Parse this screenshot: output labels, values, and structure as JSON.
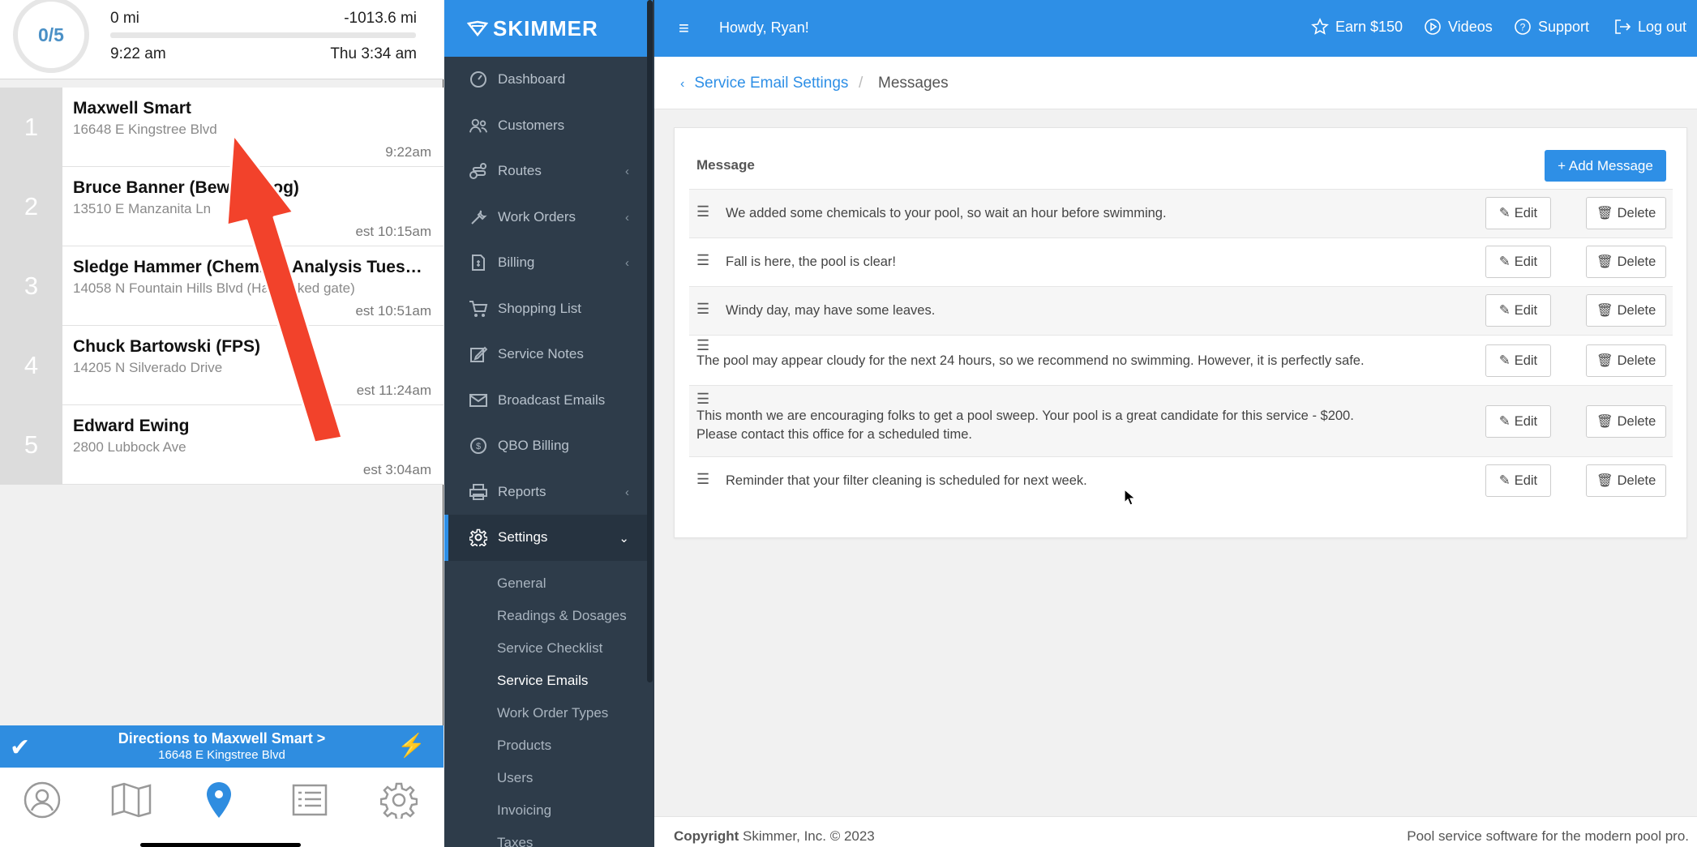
{
  "mobile": {
    "progress": "0/5",
    "distance_left": "0 mi",
    "distance_right": "-1013.6 mi",
    "time_left": "9:22 am",
    "time_right": "Thu 3:34 am",
    "stops": [
      {
        "num": "1",
        "name": "Maxwell Smart",
        "address": "16648 E Kingstree Blvd",
        "time": "9:22am"
      },
      {
        "num": "2",
        "name": "Bruce Banner (Beware Dog)",
        "address": "13510 E Manzanita Ln",
        "time": "est 10:15am"
      },
      {
        "num": "3",
        "name": "Sledge Hammer (Chemical Analysis Tuesday)",
        "address": "14058 N Fountain Hills Blvd (Has locked gate)",
        "time": "est 10:51am"
      },
      {
        "num": "4",
        "name": "Chuck Bartowski (FPS)",
        "address": "14205 N Silverado Drive",
        "time": "est 11:24am"
      },
      {
        "num": "5",
        "name": "Edward Ewing",
        "address": "2800 Lubbock Ave",
        "time": "est 3:04am"
      }
    ],
    "directions_title": "Directions to Maxwell Smart >",
    "directions_address": "16648 E Kingstree Blvd",
    "tabs": [
      "profile-icon",
      "map-icon",
      "location-pin-icon",
      "list-icon",
      "gear-icon"
    ],
    "accent": "#2f8de0"
  },
  "brand": "SKIMMER",
  "topbar": {
    "greeting": "Howdy, Ryan!",
    "earn": "Earn $150",
    "videos": "Videos",
    "support": "Support",
    "logout": "Log out"
  },
  "nav": [
    {
      "label": "Dashboard",
      "icon": "dashboard-icon"
    },
    {
      "label": "Customers",
      "icon": "customers-icon"
    },
    {
      "label": "Routes",
      "icon": "routes-icon"
    },
    {
      "label": "Work Orders",
      "icon": "wrench-icon"
    },
    {
      "label": "Billing",
      "icon": "billing-icon"
    },
    {
      "label": "Shopping List",
      "icon": "cart-icon"
    },
    {
      "label": "Service Notes",
      "icon": "edit-icon"
    },
    {
      "label": "Broadcast Emails",
      "icon": "envelope-icon"
    },
    {
      "label": "QBO Billing",
      "icon": "dollar-icon"
    },
    {
      "label": "Reports",
      "icon": "printer-icon"
    },
    {
      "label": "Settings",
      "icon": "gear-icon"
    }
  ],
  "settings_sub": [
    "General",
    "Readings & Dosages",
    "Service Checklist",
    "Service Emails",
    "Work Order Types",
    "Products",
    "Users",
    "Invoicing",
    "Taxes"
  ],
  "breadcrumb": {
    "parent": "Service Email Settings",
    "sep": "/",
    "current": "Messages"
  },
  "card": {
    "header": "Message",
    "add_label": "+ Add Message",
    "edit_label": "Edit",
    "delete_label": "Delete",
    "messages": [
      "We added some chemicals to your pool, so wait an hour before swimming.",
      "Fall is here, the pool is clear!",
      "Windy day, may have some leaves.",
      "The pool may appear cloudy for the next 24 hours, so we recommend no swimming. However, it is perfectly safe.",
      "This month we are encouraging folks to get a pool sweep. Your pool is a great candidate for this service - $200.",
      "Please contact this office for a scheduled time.",
      "Reminder that your filter cleaning is scheduled for next week."
    ]
  },
  "footer": {
    "copyright_bold": "Copyright",
    "copyright_text": " Skimmer, Inc. © 2023",
    "tagline": "Pool service software for the modern pool pro."
  },
  "colors": {
    "primary": "#2e8fe6",
    "sidebar": "#2e3c4a",
    "annotation_arrow": "#f2422b"
  }
}
